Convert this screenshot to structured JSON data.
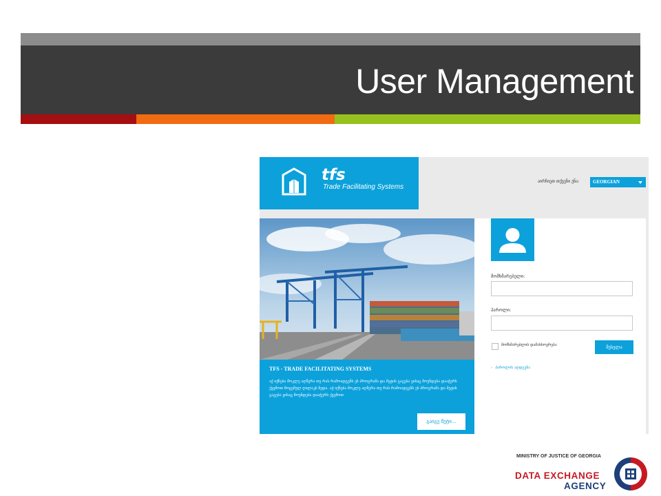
{
  "slide": {
    "title": "User Management",
    "colors": {
      "title_bar": "#3b3b3b",
      "title_top": "#8c8c8c",
      "accent_red": "#a50f11",
      "accent_orange": "#f06b12",
      "accent_green": "#96c11f"
    }
  },
  "screenshot": {
    "brand": {
      "name": "tfs",
      "subtitle": "Trade Facilitating Systems",
      "color": "#0ca1db"
    },
    "language": {
      "label": "აირჩიეთ თქვენი ენა:",
      "selected": "GEORGIAN"
    },
    "promo": {
      "title": "TFS - TRADE FACILITATING SYSTEMS",
      "body": "აქ იქნება მოკლე აღწერა თუ რას რამოადგენს ეს პროგრამა და მეტის გაგება ვისაც მოუნდება დააჭერს ქვემოთ მოცემულ ღილაკს ზედა. აქ იქნება მოკლე აღწერა თუ რას რამოადგენს ეს პროგრამა და მეტის გაგება ვისაც მოუნდება დააჭერს ქვემოთ",
      "more_label": "გაიგე მეტი..."
    },
    "login": {
      "username_label": "მომხმარებელი:",
      "username_value": "",
      "password_label": "პაროლი:",
      "password_value": "",
      "remember_label": "მომხმარებლის დამახსოვრება",
      "submit_label": "შესვლა",
      "forgot_label": "პაროლის აღდგენა"
    }
  },
  "footer": {
    "ministry": "MINISTRY OF JUSTICE OF GEORGIA",
    "agency_line1": "DATA EXCHANGE",
    "agency_line2": "AGENCY"
  }
}
